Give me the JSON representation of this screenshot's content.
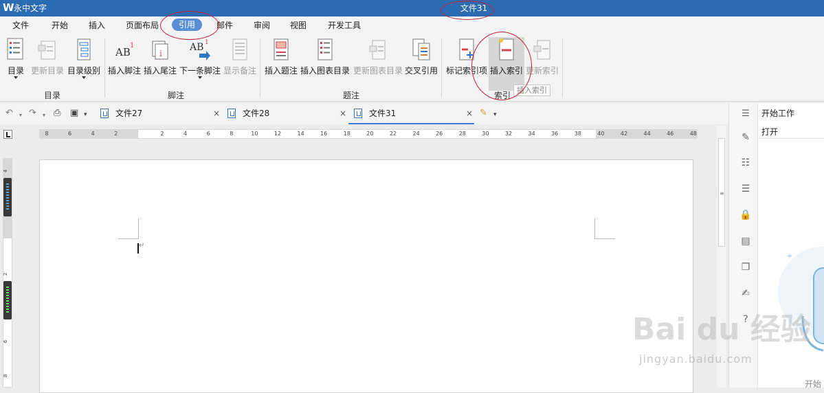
{
  "app": {
    "logo": "W",
    "name": "永中文字",
    "title": "文件31"
  },
  "menu": {
    "items": [
      "文件",
      "开始",
      "插入",
      "页面布局",
      "引用",
      "邮件",
      "审阅",
      "视图",
      "开发工具"
    ],
    "active": "引用"
  },
  "ribbon": {
    "buttons": {
      "toc": "目录",
      "update_toc": "更新目录",
      "toc_level": "目录级别",
      "insert_footnote": "插入脚注",
      "insert_endnote": "插入尾注",
      "next_footnote": "下一条脚注",
      "show_notes": "显示备注",
      "insert_caption": "插入题注",
      "insert_table_of_figures": "插入图表目录",
      "update_table_of_figures": "更新图表目录",
      "cross_reference": "交叉引用",
      "mark_index_entry": "标记索引项",
      "insert_index": "插入索引",
      "update_index": "更新索引"
    },
    "groups": {
      "toc": "目录",
      "footnotes": "脚注",
      "captions": "题注",
      "index": "索引"
    },
    "tooltip": "插入索引",
    "icon_labels": {
      "footnote": "AB",
      "superscript": "1",
      "endnote": "i"
    }
  },
  "tabs": [
    {
      "label": "文件27",
      "close": "×"
    },
    {
      "label": "文件28",
      "close": "×"
    },
    {
      "label": "文件31",
      "close": "×"
    }
  ],
  "ruler": {
    "horizontal": [
      "8",
      "6",
      "4",
      "2",
      "2",
      "4",
      "6",
      "8",
      "10",
      "12",
      "14",
      "16",
      "18",
      "20",
      "22",
      "24",
      "26",
      "28",
      "30",
      "32",
      "34",
      "36",
      "38",
      "40",
      "42",
      "44",
      "46",
      "48"
    ],
    "vertical": [
      "4",
      "2",
      "2",
      "4",
      "6",
      "8"
    ]
  },
  "taskpane": {
    "title": "开始工作",
    "open": "打开",
    "bottom_text": "开始"
  },
  "watermark": {
    "main": "Bai du 经验",
    "sub": "jingyan.baidu.com"
  },
  "colors": {
    "titlebar": "#2a6bb1",
    "accent": "#5a8fd6",
    "annotation": "#c7203a"
  }
}
